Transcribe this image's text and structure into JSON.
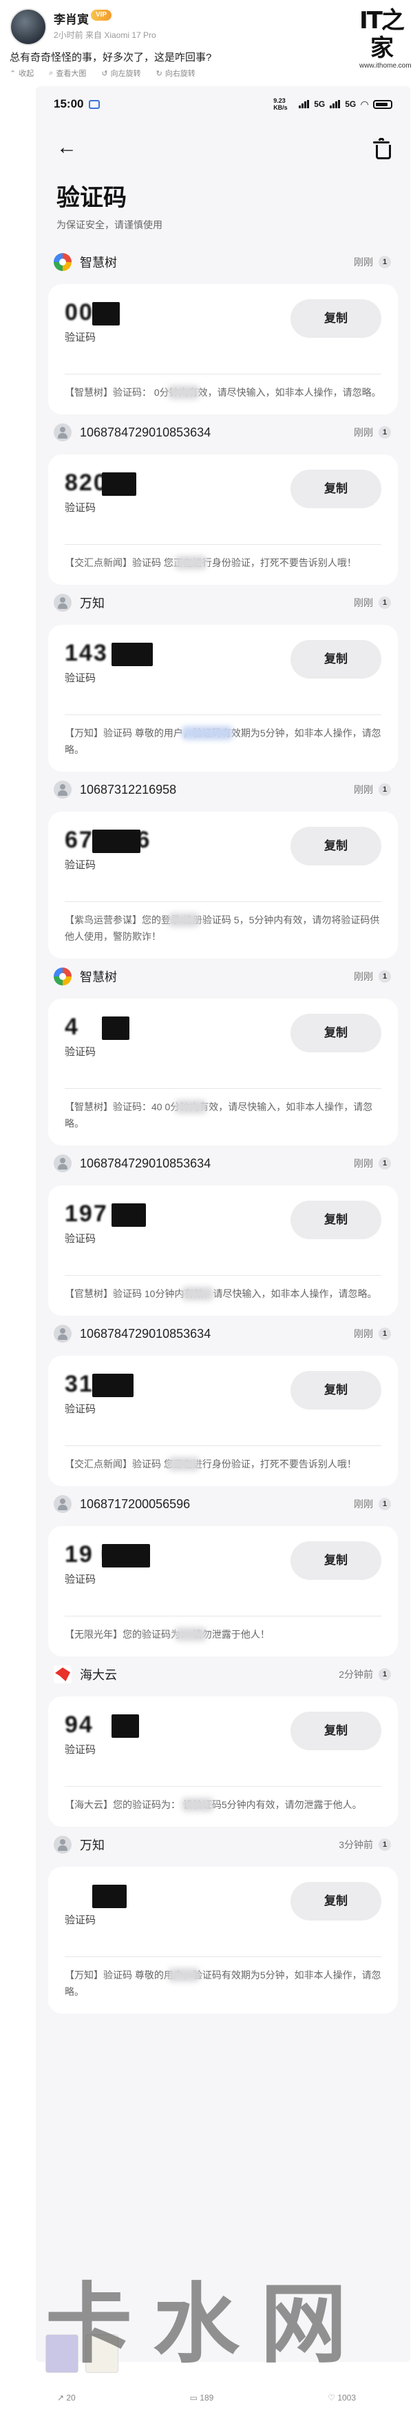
{
  "post": {
    "username": "李肖寅",
    "vip_badge": "VIP",
    "meta": "2小时前 来自 Xiaomi 17 Pro",
    "text": "总有奇奇怪怪的事，好多次了，这是咋回事?",
    "actions": [
      "收起",
      "查看大图",
      "向左旋转",
      "向右旋转"
    ]
  },
  "logo": {
    "mark": "IT之家",
    "url": "www.ithome.com"
  },
  "phone": {
    "status": {
      "time": "15:00",
      "speed": "9.23 KB/s",
      "network": "5G",
      "network2": "5G"
    },
    "title": "验证码",
    "subtitle": "为保证安全，请谨慎使用",
    "copy_label": "复制",
    "code_label": "验证码"
  },
  "messages": [
    {
      "sender": "智慧树",
      "icon": "tree-icon",
      "time": "刚刚",
      "count": "1",
      "code": "007",
      "text": "【智慧树】验证码：        0分钟内有效，请尽快输入，如非本人操作，请忽略。"
    },
    {
      "sender": "1068784729010853634",
      "icon": "person-icon",
      "time": "刚刚",
      "count": "1",
      "code": "8207",
      "text": "【交汇点新闻】验证码        您正在进行身份验证，打死不要告诉别人哦！"
    },
    {
      "sender": "万知",
      "icon": "person-icon",
      "time": "刚刚",
      "count": "1",
      "code": "143",
      "text": "【万知】验证码              尊敬的用户，验证码有效期为5分钟，如非本人操作，请忽略。"
    },
    {
      "sender": "10687312216958",
      "icon": "person-icon",
      "time": "刚刚",
      "count": "1",
      "code": "670126",
      "text": "【紫鸟运营参谋】您的登录/注册验证码           5，5分钟内有效，请勿将验证码供他人使用，警防欺诈！"
    },
    {
      "sender": "智慧树",
      "icon": "tree-icon",
      "time": "刚刚",
      "count": "1",
      "code": "4",
      "text": "【智慧树】验证码：40    0分钟内有效，请尽快输入，如非本人操作，请忽略。"
    },
    {
      "sender": "1068784729010853634",
      "icon": "person-icon",
      "time": "刚刚",
      "count": "1",
      "code": "197",
      "text": "【官慧树】验证码        10分钟内有效，请尽快输入，如非本人操作，请忽略。"
    },
    {
      "sender": "1068784729010853634",
      "icon": "person-icon",
      "time": "刚刚",
      "count": "1",
      "code": "312",
      "text": "【交汇点新闻】验证码        您正在进行身份验证，打死不要告诉别人哦！"
    },
    {
      "sender": "1068717200056596",
      "icon": "person-icon",
      "time": "刚刚",
      "count": "1",
      "code": "19   00",
      "text": "【无限光年】您的验证码为：            请勿泄露于他人！"
    },
    {
      "sender": "海大云",
      "icon": "haidayun-icon",
      "time": "2分钟前",
      "count": "1",
      "code": "94",
      "text": "【海大云】您的验证码为：        该验证码5分钟内有效，请勿泄露于他人。"
    },
    {
      "sender": "万知",
      "icon": "person-icon",
      "time": "3分钟前",
      "count": "1",
      "code": "",
      "text": "【万知】验证码        尊敬的用户，验证码有效期为5分钟，如非本人操作，请忽略。"
    }
  ],
  "watermark": "卡水网",
  "bottom_bar": {
    "share": "20",
    "comments": "189",
    "likes": "1003"
  }
}
